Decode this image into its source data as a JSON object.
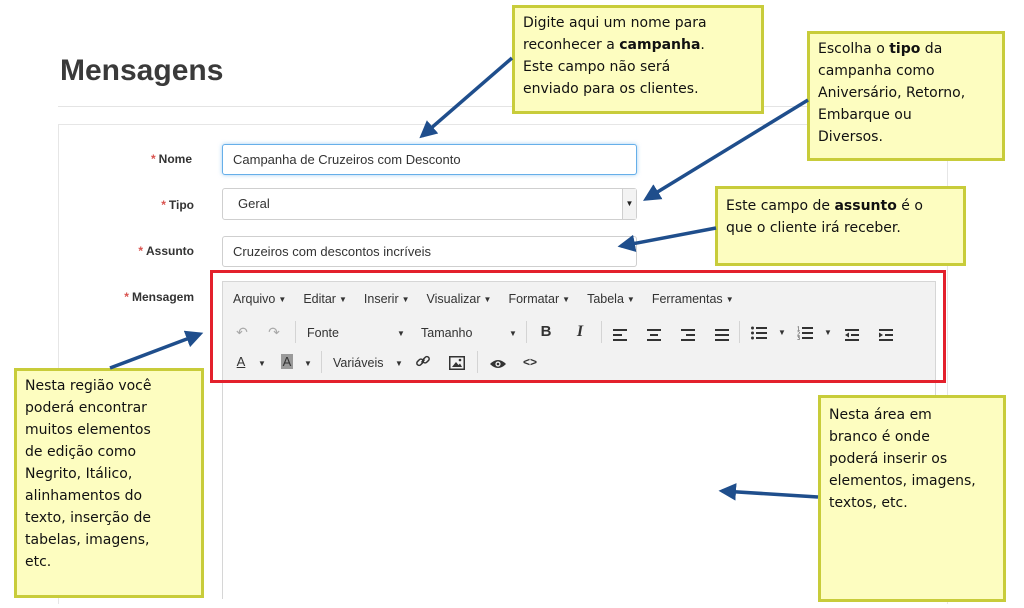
{
  "page": {
    "title": "Mensagens"
  },
  "form": {
    "required_mark": "*",
    "nome": {
      "label": "Nome",
      "value": "Campanha de Cruzeiros com Desconto"
    },
    "tipo": {
      "label": "Tipo",
      "selected": "Geral"
    },
    "assunto": {
      "label": "Assunto",
      "value": "Cruzeiros com descontos incríveis"
    },
    "mensagem": {
      "label": "Mensagem"
    }
  },
  "editor": {
    "menus": [
      "Arquivo",
      "Editar",
      "Inserir",
      "Visualizar",
      "Formatar",
      "Tabela",
      "Ferramentas"
    ],
    "font_dropdown": "Fonte",
    "size_dropdown": "Tamanho",
    "bold_glyph": "B",
    "italic_glyph": "I",
    "text_color_glyph": "A",
    "bg_color_glyph": "A",
    "variables_dropdown": "Variáveis",
    "source_glyph": "<>"
  },
  "notes": {
    "nome": [
      "Digite aqui um nome para",
      "reconhecer a ",
      "campanha",
      ".",
      "Este campo não será",
      "enviado para os clientes."
    ],
    "tipo": [
      "Escolha o ",
      "tipo",
      " da",
      "campanha como",
      "Aniversário, Retorno,",
      "Embarque ou",
      "Diversos."
    ],
    "assunto": [
      "Este campo de ",
      "assunto",
      " é o",
      "que o cliente irá receber."
    ],
    "toolbar": [
      "Nesta região você",
      "poderá encontrar",
      "muitos elementos",
      "de edição como",
      "Negrito, Itálico,",
      "alinhamentos do",
      "texto, inserção de",
      "tabelas, imagens,",
      "etc."
    ],
    "area": [
      "Nesta área em",
      "branco é onde",
      "poderá inserir os",
      "elementos, imagens,",
      "textos, etc."
    ]
  },
  "colors": {
    "note_bg": "#fdfdc0",
    "note_border": "#c8cc3a",
    "arrow": "#1f4e8c",
    "highlight": "#e3202c",
    "required": "#d9534f"
  }
}
